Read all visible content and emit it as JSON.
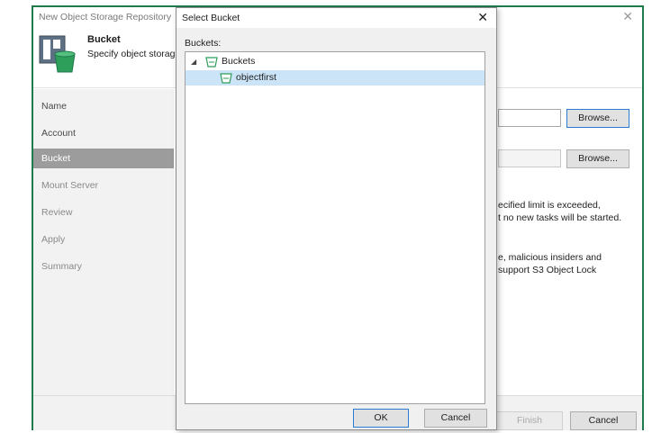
{
  "colors": {
    "window_border": "#1f7a4c",
    "accent_green": "#2e9e5b",
    "selection": "#cce4f7",
    "nav_active": "#9c9c9c"
  },
  "wizard": {
    "title": "New Object Storage Repository",
    "header": {
      "step_title": "Bucket",
      "step_description": "Specify object storage"
    },
    "nav_items": [
      {
        "label": "Name",
        "state": "done"
      },
      {
        "label": "Account",
        "state": "done"
      },
      {
        "label": "Bucket",
        "state": "active"
      },
      {
        "label": "Mount Server",
        "state": "pending"
      },
      {
        "label": "Review",
        "state": "pending"
      },
      {
        "label": "Apply",
        "state": "pending"
      },
      {
        "label": "Summary",
        "state": "pending"
      }
    ],
    "content": {
      "browse_label_1": "Browse...",
      "browse_label_2": "Browse...",
      "text_line_1": "ecified limit is exceeded,",
      "text_line_2": "t no new tasks will be started.",
      "text_line_3": "e, malicious insiders and",
      "text_line_4": "support S3 Object Lock"
    },
    "footer": {
      "finish_label": "Finish",
      "cancel_label": "Cancel"
    }
  },
  "dialog": {
    "title": "Select Bucket",
    "buckets_label": "Buckets:",
    "tree": {
      "root": {
        "label": "Buckets",
        "icon": "bucket-icon",
        "expanded": true
      },
      "children": [
        {
          "label": "objectfirst",
          "icon": "bucket-icon",
          "selected": true
        }
      ]
    },
    "ok_label": "OK",
    "cancel_label": "Cancel"
  }
}
